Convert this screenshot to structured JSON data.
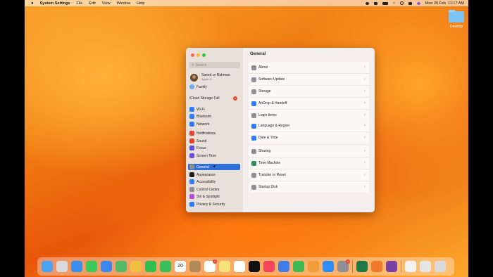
{
  "menubar": {
    "apple_icon": "apple-icon",
    "app_name": "System Settings",
    "menus": [
      "File",
      "Edit",
      "View",
      "Window",
      "Help"
    ],
    "clock": "Mon 20 Feb  11:17 AM"
  },
  "desktop": {
    "folder_label": "Desktop"
  },
  "window": {
    "search_placeholder": "Search",
    "user": {
      "name": "Saeed ur Rahman",
      "subtitle": "Apple ID"
    },
    "family": "Family",
    "icloud": {
      "label": "iCloud Storage Full",
      "badge": "1"
    },
    "sidebar_groups": [
      [
        {
          "label": "Wi-Fi",
          "color": "#2f7df6"
        },
        {
          "label": "Bluetooth",
          "color": "#2f7df6"
        },
        {
          "label": "Network",
          "color": "#2f7df6"
        }
      ],
      [
        {
          "label": "Notifications",
          "color": "#e8412f"
        },
        {
          "label": "Sound",
          "color": "#e8412f"
        },
        {
          "label": "Focus",
          "color": "#5b4fd6"
        },
        {
          "label": "Screen Time",
          "color": "#6a4fd6"
        }
      ],
      [
        {
          "label": "General",
          "color": "#8e8e93",
          "selected": true
        },
        {
          "label": "Appearance",
          "color": "#1c1c1e"
        },
        {
          "label": "Accessibility",
          "color": "#2f7df6"
        },
        {
          "label": "Control Centre",
          "color": "#8e8e93"
        },
        {
          "label": "Siri & Spotlight",
          "color": "#b14fd6"
        },
        {
          "label": "Privacy & Security",
          "color": "#2f7df6"
        }
      ]
    ],
    "main_title": "General",
    "groups": [
      [
        {
          "label": "About",
          "color": "#8e8e93"
        },
        {
          "label": "Software Update",
          "color": "#8e8e93"
        },
        {
          "label": "Storage",
          "color": "#8e8e93"
        },
        {
          "label": "AirDrop & Handoff",
          "color": "#2f7df6"
        },
        {
          "label": "Login Items",
          "color": "#8e8e93"
        }
      ],
      [
        {
          "label": "Language & Region",
          "color": "#2f7df6"
        },
        {
          "label": "Date & Time",
          "color": "#2f7df6"
        }
      ],
      [
        {
          "label": "Sharing",
          "color": "#8e8e93"
        },
        {
          "label": "Time Machine",
          "color": "#2f8a5a"
        },
        {
          "label": "Transfer or Reset",
          "color": "#8e8e93"
        },
        {
          "label": "Startup Disk",
          "color": "#8e8e93"
        }
      ]
    ]
  },
  "dock": {
    "apps": [
      {
        "name": "finder-icon",
        "color": "#4aa3f5"
      },
      {
        "name": "launchpad-icon",
        "color": "#d9d9de"
      },
      {
        "name": "safari-icon",
        "color": "#3a8ef0"
      },
      {
        "name": "messages-icon",
        "color": "#3cc95a"
      },
      {
        "name": "mail-icon",
        "color": "#3b89f0"
      },
      {
        "name": "maps-icon",
        "color": "#55b96a"
      },
      {
        "name": "photos-icon",
        "color": "#f0c040"
      },
      {
        "name": "whatsapp-icon",
        "color": "#2fbf4f"
      },
      {
        "name": "facetime-icon",
        "color": "#38c05a"
      },
      {
        "name": "calendar-icon",
        "color": "#ffffff",
        "text": "20"
      },
      {
        "name": "contacts-icon",
        "color": "#b08a5a"
      },
      {
        "name": "reminders-icon",
        "color": "#ffffff",
        "badge": "2"
      },
      {
        "name": "notes-icon",
        "color": "#f7e27a"
      },
      {
        "name": "freeform-icon",
        "color": "#ffffff"
      },
      {
        "name": "apple-tv-icon",
        "color": "#111111"
      },
      {
        "name": "music-icon",
        "color": "#f5455c"
      },
      {
        "name": "keynote-icon",
        "color": "#3f7ee8"
      },
      {
        "name": "numbers-icon",
        "color": "#3fb84f"
      },
      {
        "name": "pages-icon",
        "color": "#f29c36"
      },
      {
        "name": "app-store-icon",
        "color": "#2f8df5"
      },
      {
        "name": "system-settings-icon",
        "color": "#8e8e93",
        "badge": "1"
      },
      {
        "name": "excel-icon",
        "color": "#1f7a45"
      },
      {
        "name": "firefox-icon",
        "color": "#f07a2a"
      },
      {
        "name": "tor-browser-icon",
        "color": "#7b3fa8"
      },
      {
        "name": "preview-icon",
        "color": "#f2f2f2"
      },
      {
        "name": "screenshot-icon",
        "color": "#e6e6e6"
      },
      {
        "name": "trash-icon",
        "color": "#d9d9de"
      }
    ],
    "calendar_text": "20",
    "reminders_badge": "2",
    "settings_badge": "1"
  }
}
